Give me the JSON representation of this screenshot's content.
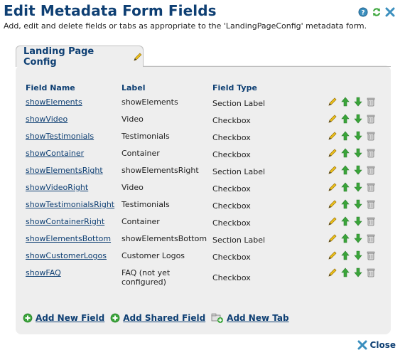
{
  "title": "Edit Metadata Form Fields",
  "subtitle": "Add, edit and delete fields or tabs as appropriate to the 'LandingPageConfig' metadata form.",
  "tab": {
    "label": "Landing Page Config"
  },
  "columns": {
    "name": "Field Name",
    "label": "Label",
    "type": "Field Type"
  },
  "rows": [
    {
      "name": "showElements",
      "label": "showElements",
      "type": "Section Label"
    },
    {
      "name": "showVideo",
      "label": "Video",
      "type": "Checkbox"
    },
    {
      "name": "showTestimonials",
      "label": "Testimonials",
      "type": "Checkbox"
    },
    {
      "name": "showContainer",
      "label": "Container",
      "type": "Checkbox"
    },
    {
      "name": "showElementsRight",
      "label": "showElementsRight",
      "type": "Section Label"
    },
    {
      "name": "showVideoRight",
      "label": "Video",
      "type": "Checkbox"
    },
    {
      "name": "showTestimonialsRight",
      "label": "Testimonials",
      "type": "Checkbox"
    },
    {
      "name": "showContainerRight",
      "label": "Container",
      "type": "Checkbox"
    },
    {
      "name": "showElementsBottom",
      "label": "showElementsBottom",
      "type": "Section Label"
    },
    {
      "name": "showCustomerLogos",
      "label": "Customer Logos",
      "type": "Checkbox"
    },
    {
      "name": "showFAQ",
      "label": "FAQ (not yet configured)",
      "type": "Checkbox"
    }
  ],
  "links": {
    "add_field": "Add New Field",
    "add_shared": "Add Shared Field",
    "add_tab": "Add New Tab"
  },
  "close_label": "Close",
  "icons": {
    "help": "help-icon",
    "refresh": "refresh-icon",
    "close": "close-icon",
    "edit": "pencil-icon",
    "up": "arrow-up-icon",
    "down": "arrow-down-icon",
    "delete": "trash-icon",
    "add": "plus-circle-icon",
    "tab": "tab-add-icon"
  },
  "colors": {
    "title": "#0e3f73",
    "panel": "#eeeeee",
    "close": "#3b8fbe",
    "green": "#3aa53a"
  }
}
